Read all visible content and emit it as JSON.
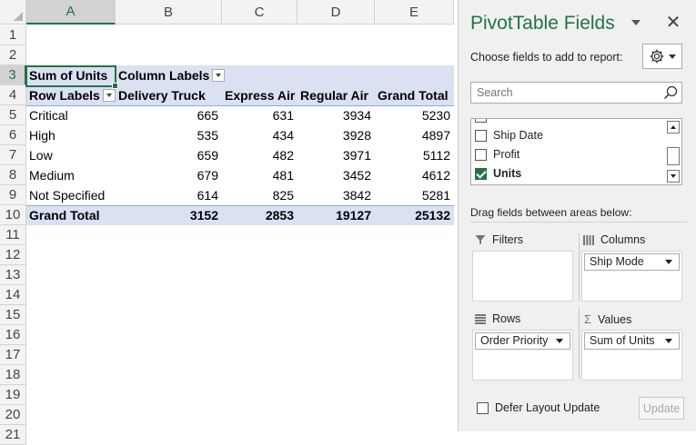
{
  "grid": {
    "columns": [
      "A",
      "B",
      "C",
      "D",
      "E"
    ],
    "rows": [
      "1",
      "2",
      "3",
      "4",
      "5",
      "6",
      "7",
      "8",
      "9",
      "10",
      "11",
      "12",
      "13",
      "14",
      "15",
      "16",
      "17",
      "18",
      "19",
      "20",
      "21"
    ],
    "pivot": {
      "sum_label": "Sum of Units",
      "column_labels": "Column Labels",
      "row_labels": "Row Labels",
      "headers": [
        "Delivery Truck",
        "Express Air",
        "Regular Air",
        "Grand Total"
      ],
      "data_rows": [
        {
          "label": "Critical",
          "values": [
            "665",
            "631",
            "3934",
            "5230"
          ]
        },
        {
          "label": "High",
          "values": [
            "535",
            "434",
            "3928",
            "4897"
          ]
        },
        {
          "label": "Low",
          "values": [
            "659",
            "482",
            "3971",
            "5112"
          ]
        },
        {
          "label": "Medium",
          "values": [
            "679",
            "481",
            "3452",
            "4612"
          ]
        },
        {
          "label": "Not Specified",
          "values": [
            "614",
            "825",
            "3842",
            "5281"
          ]
        }
      ],
      "total": {
        "label": "Grand Total",
        "values": [
          "3152",
          "2853",
          "19127",
          "25132"
        ]
      }
    }
  },
  "pane": {
    "title": "PivotTable Fields",
    "choose_label": "Choose fields to add to report:",
    "search_placeholder": "Search",
    "fields": [
      {
        "label": "Ship Date",
        "checked": false
      },
      {
        "label": "Profit",
        "checked": false
      },
      {
        "label": "Units",
        "checked": true
      }
    ],
    "drag_label": "Drag fields between areas below:",
    "areas": {
      "filters": {
        "label": "Filters"
      },
      "columns": {
        "label": "Columns",
        "item": "Ship Mode"
      },
      "rows": {
        "label": "Rows",
        "item": "Order Priority"
      },
      "values": {
        "label": "Values",
        "item": "Sum of Units"
      }
    },
    "defer_label": "Defer Layout Update",
    "update_label": "Update"
  },
  "colors": {
    "accent": "#217346",
    "band": "#d9e1f2",
    "border": "#8ea9db"
  }
}
